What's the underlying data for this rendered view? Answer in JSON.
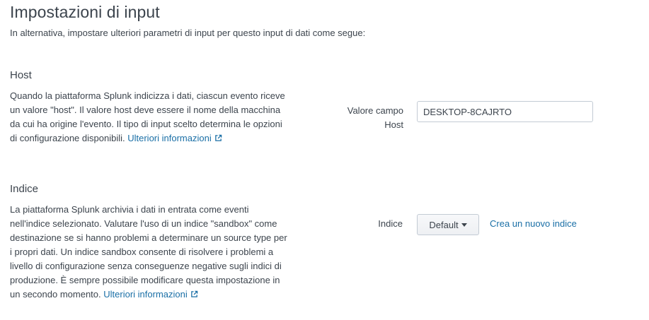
{
  "header": {
    "title": "Impostazioni di input",
    "subtitle": "In alternativa, impostare ulteriori parametri di input per questo input di dati come segue:"
  },
  "host": {
    "heading": "Host",
    "description": "Quando la piattaforma Splunk indicizza i dati, ciascun evento riceve un valore \"host\". Il valore host deve essere il nome della macchina da cui ha origine l'evento. Il tipo di input scelto determina le opzioni di configurazione disponibili.",
    "more_link": "Ulteriori informazioni",
    "field_label": "Valore campo Host",
    "field_value": "DESKTOP-8CAJRTO"
  },
  "index": {
    "heading": "Indice",
    "description": "La piattaforma Splunk archivia i dati in entrata come eventi nell'indice selezionato. Valutare l'uso di un indice \"sandbox\" come destinazione se si hanno problemi a determinare un source type per i propri dati. Un indice sandbox consente di risolvere i problemi a livello di configurazione senza conseguenze negative sugli indici di produzione. È sempre possibile modificare questa impostazione in un secondo momento.",
    "more_link": "Ulteriori informazioni",
    "field_label": "Indice",
    "selected_value": "Default",
    "create_link": "Crea un nuovo indice"
  },
  "colors": {
    "text": "#3c444d",
    "link": "#1a6fa6",
    "border": "#c3cbd4"
  },
  "icons": {
    "external_link": "external-link-icon",
    "dropdown": "caret-down-icon"
  }
}
